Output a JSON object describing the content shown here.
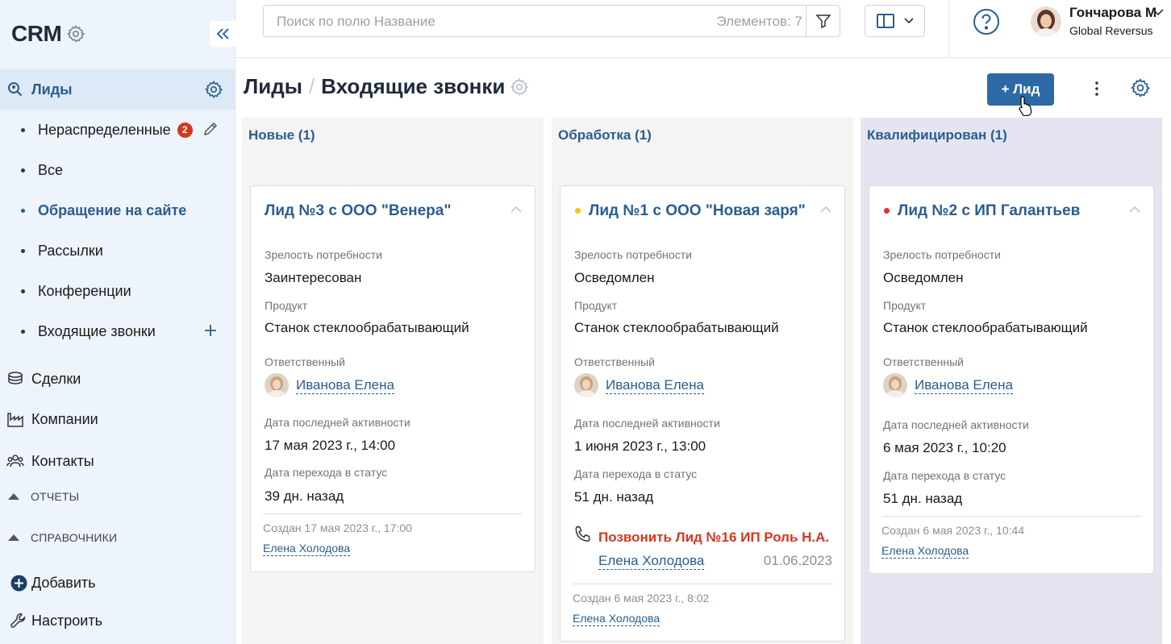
{
  "sidebar": {
    "brand": "CRM",
    "main_item": "Лиды",
    "sub_items": [
      {
        "label": "Нераспределенные",
        "badge": "2"
      },
      {
        "label": "Все"
      },
      {
        "label": "Обращение на сайте"
      },
      {
        "label": "Рассылки"
      },
      {
        "label": "Конференции"
      },
      {
        "label": "Входящие звонки"
      }
    ],
    "items": [
      "Сделки",
      "Компании",
      "Контакты"
    ],
    "sections": [
      "ОТЧЕТЫ",
      "СПРАВОЧНИКИ"
    ],
    "add_label": "Добавить",
    "configure_label": "Настроить"
  },
  "topbar": {
    "search_placeholder": "Поиск по полю Название",
    "elements_count": "Элементов: 7",
    "user_name": "Гончарова М",
    "user_org": "Global Reversus"
  },
  "page": {
    "breadcrumb_root": "Лиды",
    "breadcrumb_sep": "/",
    "title": "Входящие звонки",
    "add_button": "+ Лид"
  },
  "colors": {
    "accent": "#2c6aa5",
    "link": "#2a5d8f",
    "badge": "#d8361f",
    "yellow_dot": "#f5c400",
    "red_dot": "#e0322b",
    "column_bg_default": "#f4f4f4",
    "column_bg_highlight": "#e4e5f1"
  },
  "columns": [
    {
      "title": "Новые (1)",
      "card": {
        "title": "Лид №3 с ООО \"Венера\"",
        "maturity_label": "Зрелость потребности",
        "maturity": "Заинтересован",
        "product_label": "Продукт",
        "product": "Станок стеклообрабатывающий",
        "responsible_label": "Ответственный",
        "responsible": "Иванова Елена",
        "last_activity_label": "Дата последней активности",
        "last_activity": "17 мая 2023 г., 14:00",
        "status_change_label": "Дата перехода в статус",
        "status_change": "39 дн. назад",
        "created": "Создан   17 мая 2023 г., 17:00",
        "created_by": "Елена Холодова"
      }
    },
    {
      "title": "Обработка (1)",
      "card": {
        "title": "Лид №1 с ООО \"Новая заря\"",
        "maturity_label": "Зрелость потребности",
        "maturity": "Осведомлен",
        "product_label": "Продукт",
        "product": "Станок стеклообрабатывающий",
        "responsible_label": "Ответственный",
        "responsible": "Иванова Елена",
        "last_activity_label": "Дата последней активности",
        "last_activity": "1 июня 2023 г., 13:00",
        "status_change_label": "Дата перехода в статус",
        "status_change": "51 дн. назад",
        "task_title": "Позвонить Лид №16 ИП Роль Н.А.",
        "task_person": "Елена Холодова",
        "task_date": "01.06.2023",
        "created": "Создан   6 мая 2023 г., 8:02",
        "created_by": "Елена Холодова"
      }
    },
    {
      "title": "Квалифицирован (1)",
      "card": {
        "title": "Лид №2 с ИП Галантьев",
        "maturity_label": "Зрелость потребности",
        "maturity": "Осведомлен",
        "product_label": "Продукт",
        "product": "Станок стеклообрабатывающий",
        "responsible_label": "Ответственный",
        "responsible": "Иванова Елена",
        "last_activity_label": "Дата последней активности",
        "last_activity": "6 мая 2023 г., 10:20",
        "status_change_label": "Дата перехода в статус",
        "status_change": "51 дн. назад",
        "created": "Создан   6 мая 2023 г., 10:44",
        "created_by": "Елена Холодова"
      }
    }
  ]
}
